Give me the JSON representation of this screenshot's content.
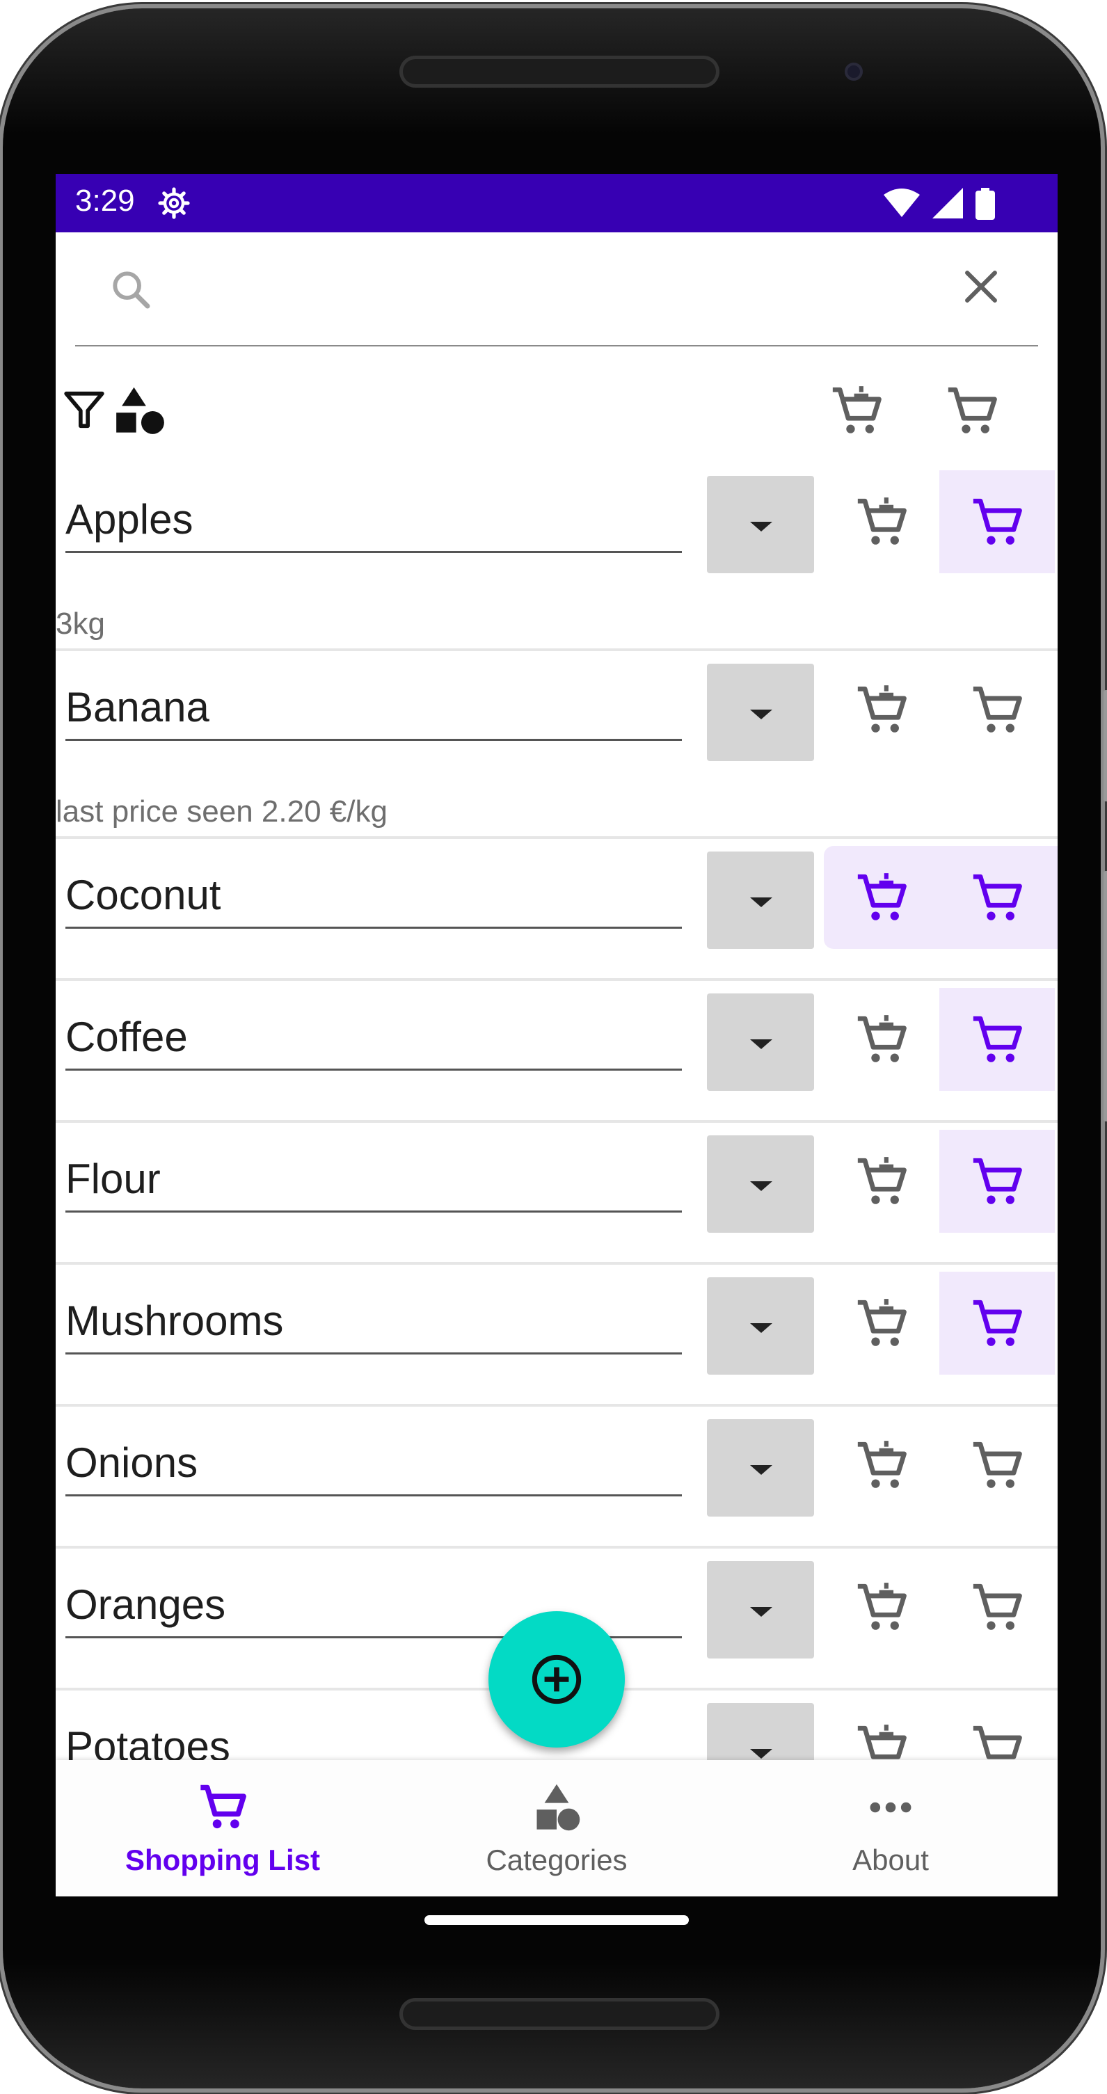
{
  "status_bar": {
    "time": "3:29",
    "color": "#3700b3"
  },
  "search": {
    "value": "",
    "placeholder": ""
  },
  "toolbar": {
    "icons": [
      "filter-icon",
      "shapes-icon",
      "cart-remove-all-icon",
      "cart-add-all-icon"
    ]
  },
  "items": [
    {
      "name": "Apples",
      "subtitle": "3kg",
      "cart_remove_selected": false,
      "cart_selected": true
    },
    {
      "name": "Banana",
      "subtitle": "last price seen 2.20 €/kg",
      "cart_remove_selected": false,
      "cart_selected": false
    },
    {
      "name": "Coconut",
      "subtitle": "",
      "cart_remove_selected": true,
      "cart_selected": true
    },
    {
      "name": "Coffee",
      "subtitle": "",
      "cart_remove_selected": false,
      "cart_selected": true
    },
    {
      "name": "Flour",
      "subtitle": "",
      "cart_remove_selected": false,
      "cart_selected": true
    },
    {
      "name": "Mushrooms",
      "subtitle": "",
      "cart_remove_selected": false,
      "cart_selected": true
    },
    {
      "name": "Onions",
      "subtitle": "",
      "cart_remove_selected": false,
      "cart_selected": false
    },
    {
      "name": "Oranges",
      "subtitle": "",
      "cart_remove_selected": false,
      "cart_selected": false
    },
    {
      "name": "Potatoes",
      "subtitle": "",
      "cart_remove_selected": false,
      "cart_selected": false
    }
  ],
  "fab": {
    "icon": "add-circle-icon",
    "color": "#03dac5"
  },
  "bottom_nav": [
    {
      "label": "Shopping List",
      "icon": "cart-icon",
      "active": true
    },
    {
      "label": "Categories",
      "icon": "shapes-icon",
      "active": false
    },
    {
      "label": "About",
      "icon": "more-icon",
      "active": false
    }
  ],
  "colors": {
    "accent": "#6200ee",
    "icon_inactive": "#5f5f5f",
    "selected_bg": "#f1e9fc"
  }
}
